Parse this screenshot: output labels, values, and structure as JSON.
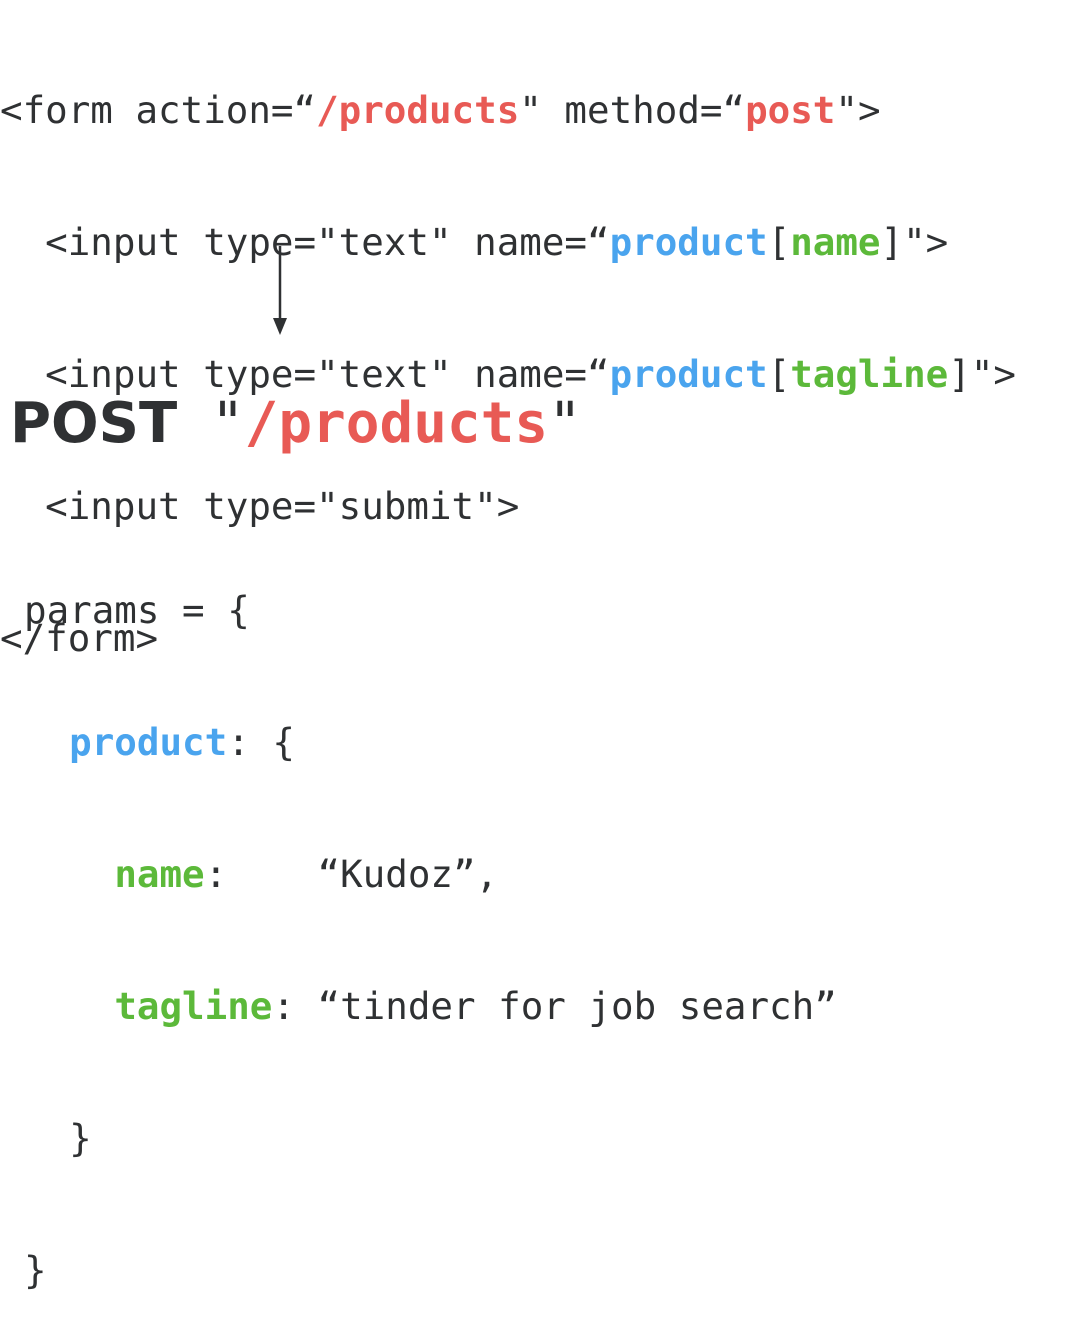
{
  "form_code": {
    "line1": {
      "p1": "<form action=“",
      "action": "/products",
      "p2": "\" method=“",
      "method": "post",
      "p3": "\">"
    },
    "line2": {
      "p1": "  <input type=\"text\" name=“",
      "model": "product",
      "p2": "[",
      "field": "name",
      "p3": "]\">"
    },
    "line3": {
      "p1": "  <input type=\"text\" name=“",
      "model": "product",
      "p2": "[",
      "field": "tagline",
      "p3": "]\">"
    },
    "line4": {
      "text": "  <input type=\"submit\">"
    },
    "line5": {
      "text": "</form>"
    }
  },
  "request": {
    "verb": "POST",
    "quote_open": " \"",
    "path": "/products",
    "quote_close": "\""
  },
  "params": {
    "line1": "params = {",
    "line2": {
      "indent": "  ",
      "key": "product",
      "rest": ": {"
    },
    "line3": {
      "indent": "    ",
      "key": "name",
      "rest": ":    “Kudoz”,"
    },
    "line4": {
      "indent": "    ",
      "key": "tagline",
      "rest": ": “tinder for job search”"
    },
    "line5": "  }",
    "line6": "}"
  },
  "colors": {
    "text": "#2f3133",
    "path_and_method": "#e85a55",
    "model_key": "#4aa4ee",
    "attribute_key": "#5cb93a"
  }
}
